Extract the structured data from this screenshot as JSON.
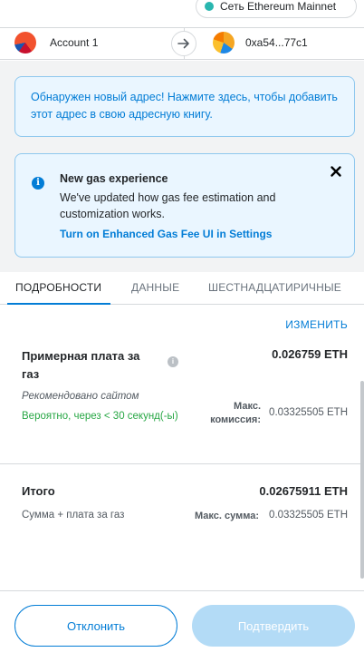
{
  "network": {
    "label": "Сеть Ethereum Mainnet",
    "dot_color": "#29b6af"
  },
  "accounts": {
    "from_name": "Account 1",
    "to_address": "0xa54...77c1",
    "arrow_icon": "arrow-right-icon"
  },
  "address_notice": {
    "text": "Обнаружен новый адрес! Нажмите здесь, чтобы добавить этот адрес в свою адресную книгу."
  },
  "gas_notice": {
    "title": "New gas experience",
    "body": "We've updated how gas fee estimation and customization works.",
    "link": "Turn on Enhanced Gas Fee UI in Settings",
    "close_icon": "close-icon",
    "info_icon": "info-icon"
  },
  "tabs": {
    "details": "ПОДРОБНОСТИ",
    "data": "ДАННЫЕ",
    "hex": "ШЕСТНАДЦАТИРИЧНЫЕ",
    "active": "details"
  },
  "details": {
    "edit_label": "ИЗМЕНИТЬ",
    "gas_fee_label": "Примерная плата за газ",
    "gas_fee_value": "0.026759 ETH",
    "recommended_label": "Рекомендовано сайтом",
    "likely_label": "Вероятно, через < 30 секунд(-ы)",
    "max_fee_label_line1": "Макс.",
    "max_fee_label_line2": "комиссия:",
    "max_fee_value": "0.03325505 ETH",
    "total_label": "Итого",
    "total_value": "0.02675911 ETH",
    "total_sub_label": "Сумма + плата за газ",
    "max_amount_label": "Макс. сумма:",
    "max_amount_value": "0.03325505 ETH"
  },
  "buttons": {
    "reject": "Отклонить",
    "confirm": "Подтвердить"
  },
  "colors": {
    "accent": "#037dd6",
    "success": "#28a745",
    "confirm_disabled": "#b3dbf6"
  }
}
